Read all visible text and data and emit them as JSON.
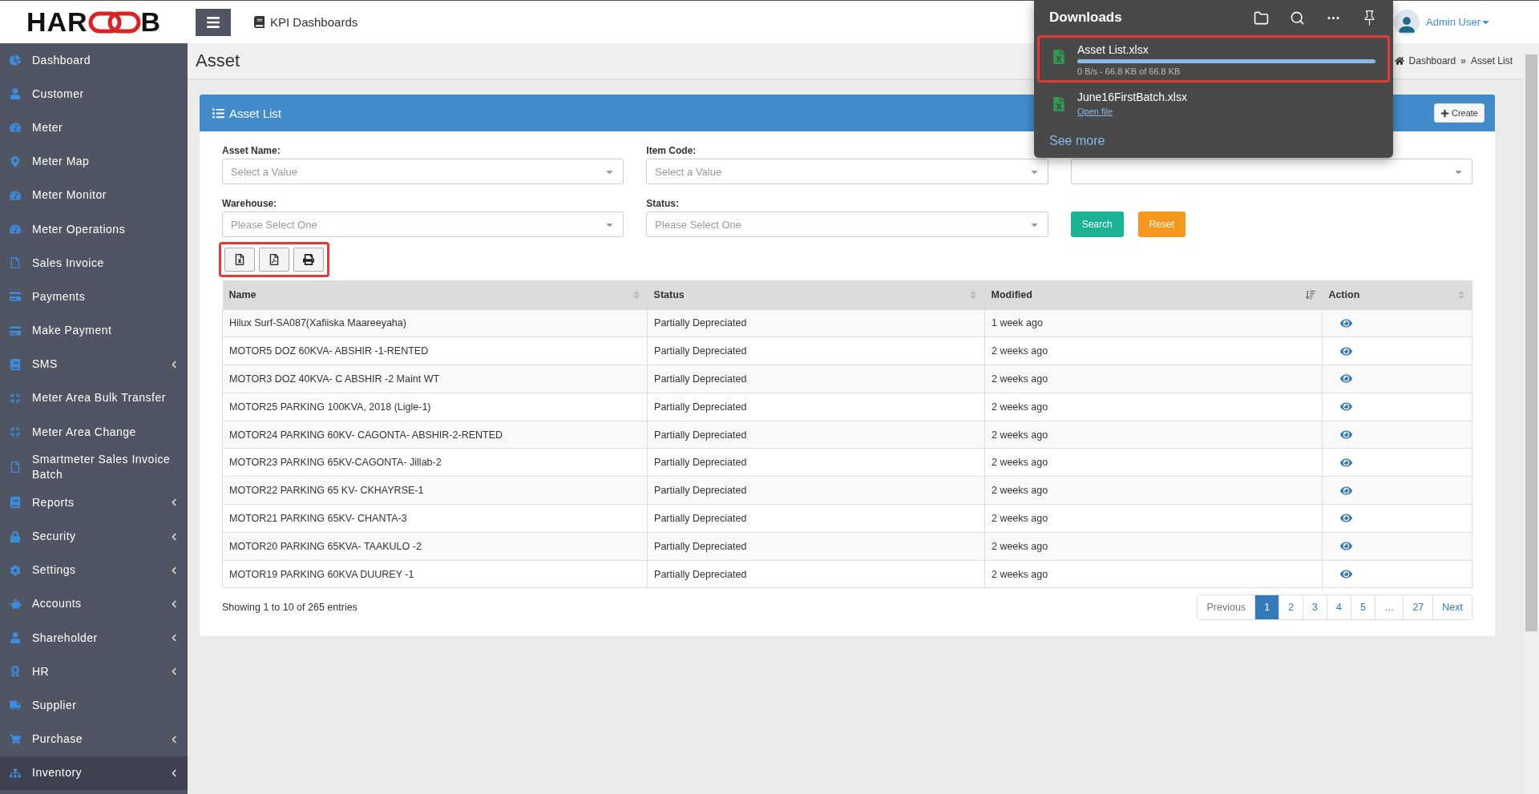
{
  "header": {
    "logo": {
      "left": "HAR",
      "right": "B"
    },
    "nav_link": "KPI Dashboards",
    "user": "Admin User"
  },
  "sidebar": {
    "items": [
      {
        "label": "Dashboard",
        "has_children": false,
        "selected": false
      },
      {
        "label": "Customer",
        "has_children": false,
        "selected": false
      },
      {
        "label": "Meter",
        "has_children": false,
        "selected": false
      },
      {
        "label": "Meter Map",
        "has_children": false,
        "selected": false
      },
      {
        "label": "Meter Monitor",
        "has_children": false,
        "selected": false
      },
      {
        "label": "Meter Operations",
        "has_children": false,
        "selected": false
      },
      {
        "label": "Sales Invoice",
        "has_children": false,
        "selected": false
      },
      {
        "label": "Payments",
        "has_children": false,
        "selected": false
      },
      {
        "label": "Make Payment",
        "has_children": false,
        "selected": false
      },
      {
        "label": "SMS",
        "has_children": true,
        "selected": false
      },
      {
        "label": "Meter Area Bulk Transfer",
        "has_children": false,
        "selected": false
      },
      {
        "label": "Meter Area Change",
        "has_children": false,
        "selected": false
      },
      {
        "label": "Smartmeter Sales Invoice Batch",
        "has_children": false,
        "selected": false
      },
      {
        "label": "Reports",
        "has_children": true,
        "selected": false
      },
      {
        "label": "Security",
        "has_children": true,
        "selected": false
      },
      {
        "label": "Settings",
        "has_children": true,
        "selected": false
      },
      {
        "label": "Accounts",
        "has_children": true,
        "selected": false
      },
      {
        "label": "Shareholder",
        "has_children": true,
        "selected": false
      },
      {
        "label": "HR",
        "has_children": true,
        "selected": false
      },
      {
        "label": "Supplier",
        "has_children": false,
        "selected": false
      },
      {
        "label": "Purchase",
        "has_children": true,
        "selected": false
      },
      {
        "label": "Inventory",
        "has_children": true,
        "selected": true
      }
    ]
  },
  "page": {
    "title": "Asset",
    "breadcrumb": [
      "Dashboard",
      "»",
      "Asset List"
    ]
  },
  "panel": {
    "title": "Asset List",
    "create_button": "Create",
    "filters": [
      {
        "label": "Asset Name:",
        "placeholder": "Select a Value"
      },
      {
        "label": "Item Code:",
        "placeholder": "Select a Value"
      },
      {
        "label": "Warehouse:",
        "placeholder": "Please Select One"
      },
      {
        "label": "Status:",
        "placeholder": "Please Select One"
      }
    ],
    "search_button": "Search",
    "reset_button": "Reset",
    "export_buttons": {
      "highlighted": true,
      "items": [
        {
          "kind": "excel"
        },
        {
          "kind": "pdf"
        },
        {
          "kind": "print"
        }
      ]
    },
    "table": {
      "columns": [
        {
          "label": "Name",
          "sorted": false
        },
        {
          "label": "Status",
          "sorted": false
        },
        {
          "label": "Modified",
          "sorted": true
        },
        {
          "label": "Action",
          "sorted": false
        }
      ],
      "rows": [
        [
          "Hilux Surf-SA087(Xafiiska Maareeyaha)",
          "Partially Depreciated",
          "1 week ago"
        ],
        [
          "MOTOR5 DOZ 60KVA- ABSHIR -1-RENTED",
          "Partially Depreciated",
          "2 weeks ago"
        ],
        [
          "MOTOR3 DOZ 40KVA- C ABSHIR -2 Maint WT",
          "Partially Depreciated",
          "2 weeks ago"
        ],
        [
          "MOTOR25 PARKING 100KVA, 2018 (Ligle-1)",
          "Partially Depreciated",
          "2 weeks ago"
        ],
        [
          "MOTOR24 PARKING 60KV- CAGONTA- ABSHIR-2-RENTED",
          "Partially Depreciated",
          "2 weeks ago"
        ],
        [
          "MOTOR23 PARKING 65KV-CAGONTA- Jillab-2",
          "Partially Depreciated",
          "2 weeks ago"
        ],
        [
          "MOTOR22 PARKING 65 KV- CKHAYRSE-1",
          "Partially Depreciated",
          "2 weeks ago"
        ],
        [
          "MOTOR21 PARKING 65KV- CHANTA-3",
          "Partially Depreciated",
          "2 weeks ago"
        ],
        [
          "MOTOR20 PARKING 65KVA- TAAKULO -2",
          "Partially Depreciated",
          "2 weeks ago"
        ],
        [
          "MOTOR19 PARKING 60KVA DUUREY -1",
          "Partially Depreciated",
          "2 weeks ago"
        ]
      ]
    },
    "summary": "Showing 1 to 10 of 265 entries",
    "pagination": [
      {
        "label": "Previous",
        "selected": false
      },
      {
        "label": "1",
        "selected": true
      },
      {
        "label": "2",
        "selected": false
      },
      {
        "label": "3",
        "selected": false
      },
      {
        "label": "4",
        "selected": false
      },
      {
        "label": "5",
        "selected": false
      },
      {
        "label": "…",
        "selected": false
      },
      {
        "label": "27",
        "selected": false
      },
      {
        "label": "Next",
        "selected": false
      }
    ]
  },
  "downloads": {
    "title": "Downloads",
    "items": [
      {
        "name": "Asset List.xlsx",
        "kind": "progress",
        "highlighted": true,
        "level": 1,
        "status": "0 B/s - 66.8 KB of 66.8 KB"
      },
      {
        "name": "June16FirstBatch.xlsx",
        "kind": "done",
        "highlighted": false,
        "link": "Open file"
      }
    ],
    "see_more": "See more"
  }
}
